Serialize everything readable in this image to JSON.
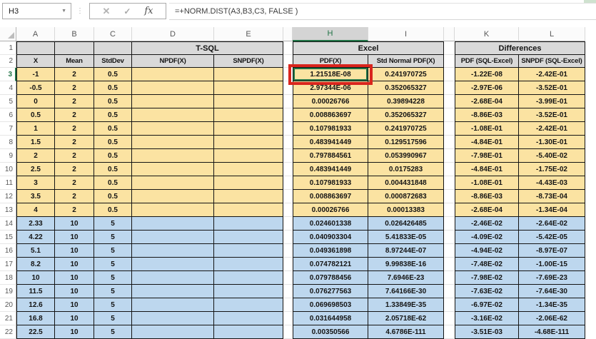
{
  "formula_bar": {
    "name_box": "H3",
    "dropdown_icon": "▼",
    "separator_icon": "⋮",
    "cancel_icon": "✕",
    "enter_icon": "✓",
    "function_icon": "fx",
    "formula": "=+NORM.DIST(A3,B3,C3, FALSE )"
  },
  "sheet": {
    "column_letters": [
      "A",
      "B",
      "C",
      "D",
      "E",
      "H",
      "I",
      "K",
      "L"
    ],
    "selected_column": "H",
    "selected_row": "3",
    "active_cell": "H3",
    "active_cell_value": "1.21518E-08",
    "header_row_numbers": [
      "1",
      "2"
    ],
    "group_headers": [
      {
        "label": "T-SQL",
        "start_col": "D",
        "end_col": "E"
      },
      {
        "label": "Excel",
        "start_col": "H",
        "end_col": "I"
      },
      {
        "label": "Differences",
        "start_col": "K",
        "end_col": "L"
      }
    ],
    "column_headers": [
      "X",
      "Mean",
      "StdDev",
      "NPDF(X)",
      "SNPDF(X)",
      "PDF(X)",
      "Std Normal PDF(X)",
      "PDF (SQL-Excel)",
      "SNPDF (SQL-Excel)"
    ],
    "rows": [
      {
        "row": "3",
        "band": "yellow",
        "cells": [
          "-1",
          "2",
          "0.5",
          "",
          "",
          "1.21518E-08",
          "0.241970725",
          "-1.22E-08",
          "-2.42E-01"
        ]
      },
      {
        "row": "4",
        "band": "yellow",
        "cells": [
          "-0.5",
          "2",
          "0.5",
          "",
          "",
          "2.97344E-06",
          "0.352065327",
          "-2.97E-06",
          "-3.52E-01"
        ]
      },
      {
        "row": "5",
        "band": "yellow",
        "cells": [
          "0",
          "2",
          "0.5",
          "",
          "",
          "0.00026766",
          "0.39894228",
          "-2.68E-04",
          "-3.99E-01"
        ]
      },
      {
        "row": "6",
        "band": "yellow",
        "cells": [
          "0.5",
          "2",
          "0.5",
          "",
          "",
          "0.008863697",
          "0.352065327",
          "-8.86E-03",
          "-3.52E-01"
        ]
      },
      {
        "row": "7",
        "band": "yellow",
        "cells": [
          "1",
          "2",
          "0.5",
          "",
          "",
          "0.107981933",
          "0.241970725",
          "-1.08E-01",
          "-2.42E-01"
        ]
      },
      {
        "row": "8",
        "band": "yellow",
        "cells": [
          "1.5",
          "2",
          "0.5",
          "",
          "",
          "0.483941449",
          "0.129517596",
          "-4.84E-01",
          "-1.30E-01"
        ]
      },
      {
        "row": "9",
        "band": "yellow",
        "cells": [
          "2",
          "2",
          "0.5",
          "",
          "",
          "0.797884561",
          "0.053990967",
          "-7.98E-01",
          "-5.40E-02"
        ]
      },
      {
        "row": "10",
        "band": "yellow",
        "cells": [
          "2.5",
          "2",
          "0.5",
          "",
          "",
          "0.483941449",
          "0.0175283",
          "-4.84E-01",
          "-1.75E-02"
        ]
      },
      {
        "row": "11",
        "band": "yellow",
        "cells": [
          "3",
          "2",
          "0.5",
          "",
          "",
          "0.107981933",
          "0.004431848",
          "-1.08E-01",
          "-4.43E-03"
        ]
      },
      {
        "row": "12",
        "band": "yellow",
        "cells": [
          "3.5",
          "2",
          "0.5",
          "",
          "",
          "0.008863697",
          "0.000872683",
          "-8.86E-03",
          "-8.73E-04"
        ]
      },
      {
        "row": "13",
        "band": "yellow",
        "cells": [
          "4",
          "2",
          "0.5",
          "",
          "",
          "0.00026766",
          "0.00013383",
          "-2.68E-04",
          "-1.34E-04"
        ]
      },
      {
        "row": "14",
        "band": "blue",
        "cells": [
          "2.33",
          "10",
          "5",
          "",
          "",
          "0.024601338",
          "0.026426485",
          "-2.46E-02",
          "-2.64E-02"
        ]
      },
      {
        "row": "15",
        "band": "blue",
        "cells": [
          "4.22",
          "10",
          "5",
          "",
          "",
          "0.040903304",
          "5.41833E-05",
          "-4.09E-02",
          "-5.42E-05"
        ]
      },
      {
        "row": "16",
        "band": "blue",
        "cells": [
          "5.1",
          "10",
          "5",
          "",
          "",
          "0.049361898",
          "8.97244E-07",
          "-4.94E-02",
          "-8.97E-07"
        ]
      },
      {
        "row": "17",
        "band": "blue",
        "cells": [
          "8.2",
          "10",
          "5",
          "",
          "",
          "0.074782121",
          "9.99838E-16",
          "-7.48E-02",
          "-1.00E-15"
        ]
      },
      {
        "row": "18",
        "band": "blue",
        "cells": [
          "10",
          "10",
          "5",
          "",
          "",
          "0.079788456",
          "7.6946E-23",
          "-7.98E-02",
          "-7.69E-23"
        ]
      },
      {
        "row": "19",
        "band": "blue",
        "cells": [
          "11.5",
          "10",
          "5",
          "",
          "",
          "0.076277563",
          "7.64166E-30",
          "-7.63E-02",
          "-7.64E-30"
        ]
      },
      {
        "row": "20",
        "band": "blue",
        "cells": [
          "12.6",
          "10",
          "5",
          "",
          "",
          "0.069698503",
          "1.33849E-35",
          "-6.97E-02",
          "-1.34E-35"
        ]
      },
      {
        "row": "21",
        "band": "blue",
        "cells": [
          "16.8",
          "10",
          "5",
          "",
          "",
          "0.031644958",
          "2.05718E-62",
          "-3.16E-02",
          "-2.06E-62"
        ]
      },
      {
        "row": "22",
        "band": "blue",
        "cells": [
          "22.5",
          "10",
          "5",
          "",
          "",
          "0.00350566",
          "4.6786E-111",
          "-3.51E-03",
          "-4.68E-111"
        ]
      }
    ]
  },
  "colors": {
    "accent_green": "#217346",
    "annotation_red": "#D9251D",
    "band_yellow": "#FBE3A2",
    "band_blue": "#BDD7EE",
    "header_gray": "#D9D9D9"
  }
}
